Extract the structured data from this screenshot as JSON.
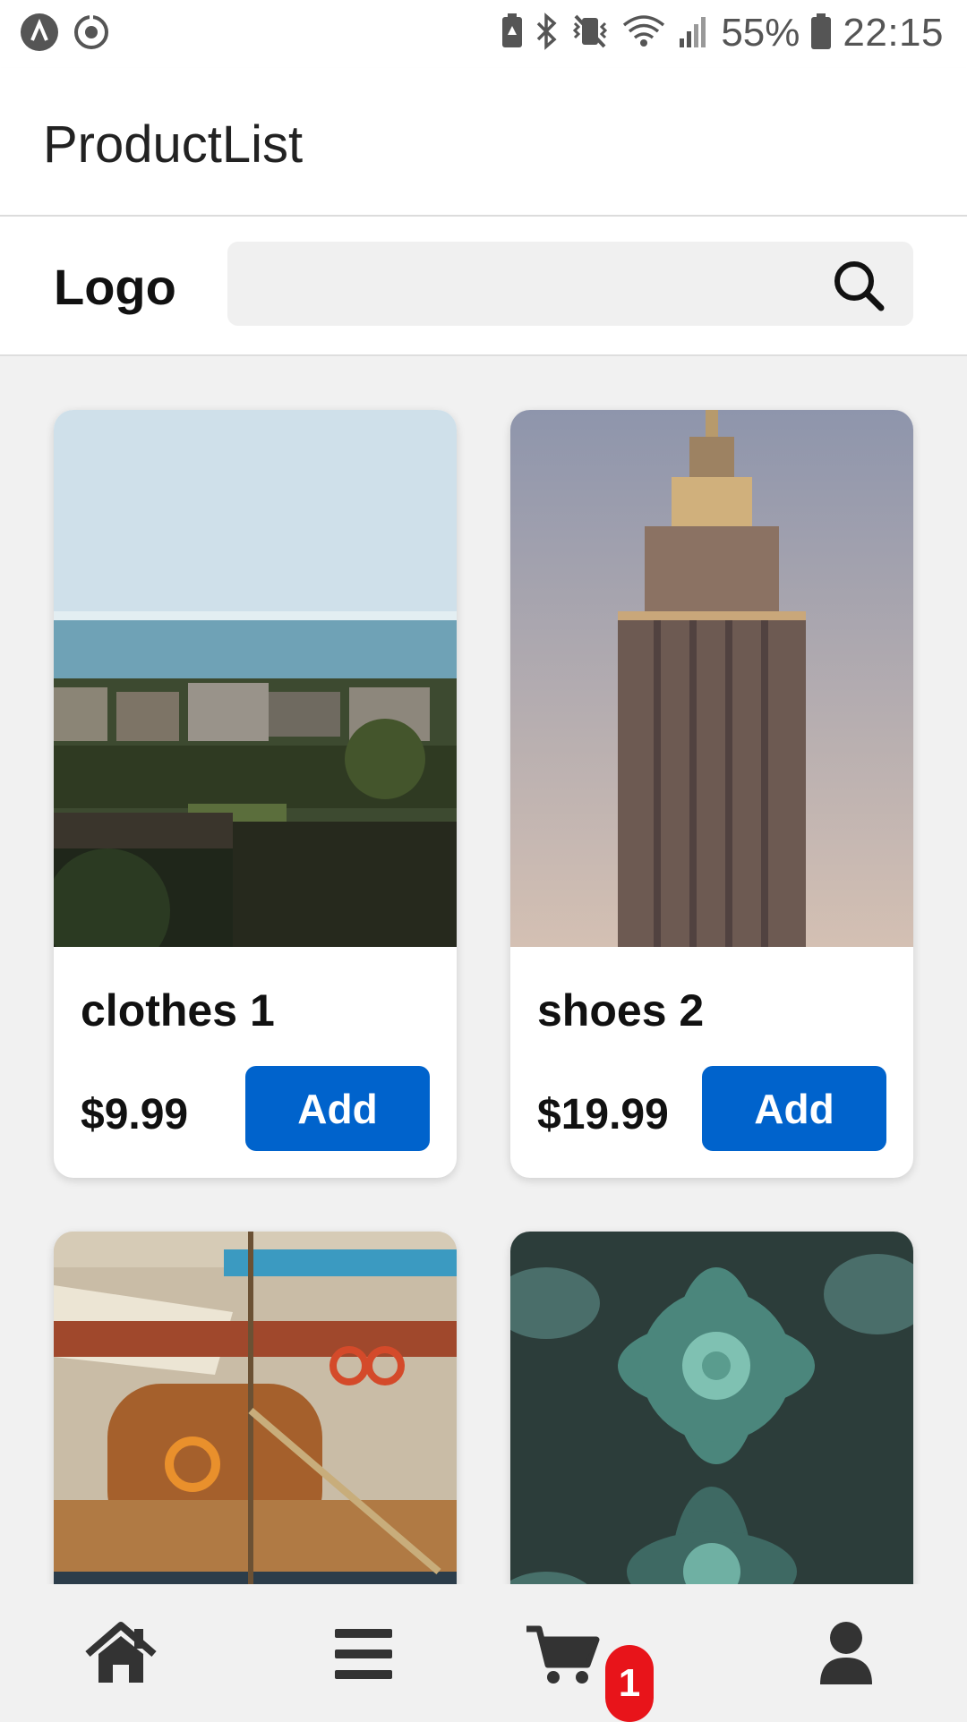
{
  "status_bar": {
    "battery_percent": "55%",
    "time": "22:15"
  },
  "app_bar": {
    "title": "ProductList"
  },
  "header": {
    "logo": "Logo",
    "search": {
      "placeholder": "",
      "value": ""
    }
  },
  "products": [
    {
      "name": "clothes 1",
      "price": "$9.99",
      "button_label": "Add",
      "image": "coastal-town-photo"
    },
    {
      "name": "shoes 2",
      "price": "$19.99",
      "button_label": "Add",
      "image": "skyscraper-photo"
    },
    {
      "image": "sailboat-photo"
    },
    {
      "image": "succulent-plants-photo"
    }
  ],
  "bottom_nav": {
    "items": [
      "home-icon",
      "menu-icon",
      "cart-icon",
      "user-icon"
    ],
    "cart_badge": "1"
  },
  "colors": {
    "accent": "#0063cc",
    "badge": "#e8141a",
    "background": "#f1f1f1"
  }
}
